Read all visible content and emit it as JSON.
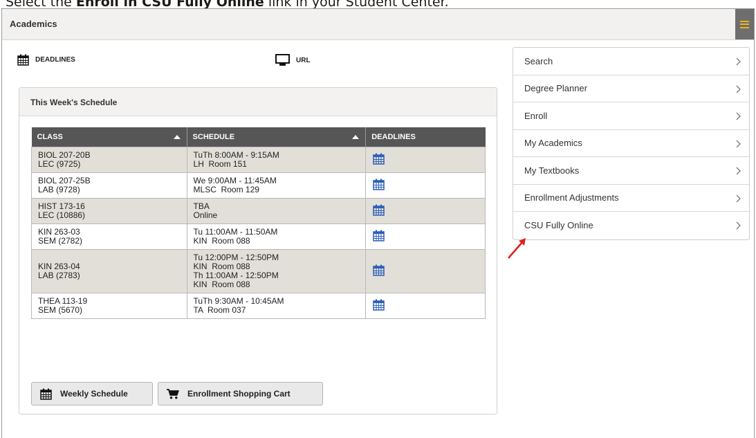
{
  "instruction": {
    "prefix": "Select the ",
    "bold": "Enroll in CSU Fully Online",
    "suffix": " link in your Student Center."
  },
  "header": {
    "title": "Academics"
  },
  "links": {
    "deadlines": "DEADLINES",
    "url": "URL"
  },
  "schedule": {
    "title": "This Week's Schedule",
    "columns": [
      "CLASS",
      "SCHEDULE",
      "DEADLINES"
    ],
    "rows": [
      {
        "class": [
          "BIOL 207-20B",
          "LEC (9725)"
        ],
        "schedule": [
          "TuTh 8:00AM - 9:15AM",
          "LH  Room 151"
        ]
      },
      {
        "class": [
          "BIOL 207-25B",
          "LAB (9728)"
        ],
        "schedule": [
          "We 9:00AM - 11:45AM",
          "MLSC  Room 129"
        ]
      },
      {
        "class": [
          "HIST 173-16",
          "LEC (10886)"
        ],
        "schedule": [
          "TBA",
          "Online"
        ]
      },
      {
        "class": [
          "KIN 263-03",
          "SEM (2782)"
        ],
        "schedule": [
          "Tu 11:00AM - 11:50AM",
          "KIN  Room 088"
        ]
      },
      {
        "class": [
          "KIN 263-04",
          "LAB (2783)"
        ],
        "schedule": [
          "Tu 12:00PM - 12:50PM",
          "KIN  Room 088",
          "Th 11:00AM - 12:50PM",
          "KIN  Room 088"
        ]
      },
      {
        "class": [
          "THEA 113-19",
          "SEM (5670)"
        ],
        "schedule": [
          "TuTh 9:30AM - 10:45AM",
          "TA  Room 037"
        ]
      }
    ],
    "buttons": {
      "weekly": "Weekly Schedule",
      "cart": "Enrollment Shopping Cart"
    }
  },
  "side_menu": {
    "items": [
      "Search",
      "Degree Planner",
      "Enroll",
      "My Academics",
      "My Textbooks",
      "Enrollment Adjustments",
      "CSU Fully Online"
    ]
  },
  "colors": {
    "header_bg": "#f2f1ef",
    "table_header": "#565656",
    "row_odd": "#e2dfd8",
    "menu_button": "#6e6e6e",
    "hamburger": "#f0b020",
    "calendar_icon": "#2b5fb8",
    "annotation_arrow": "#e02020"
  }
}
